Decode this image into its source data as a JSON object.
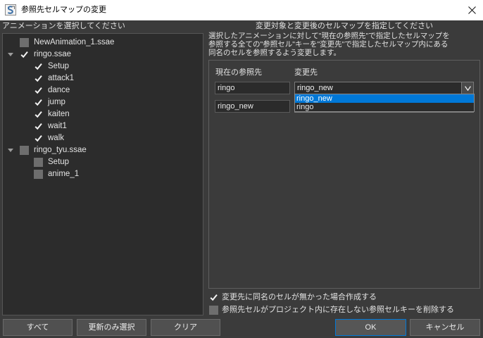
{
  "window": {
    "title": "参照先セルマップの変更"
  },
  "icons": {
    "app": "app-logo-icon",
    "close": "close-icon",
    "expand": "expand-arrow-icon",
    "dropdown": "chevron-down-icon",
    "check": "check-icon"
  },
  "animations": {
    "label": "アニメーションを選択してください",
    "tree": [
      {
        "label": "NewAnimation_1.ssae",
        "checked": false
      },
      {
        "label": "ringo.ssae",
        "checked": true,
        "expanded": true,
        "children": [
          {
            "label": "Setup",
            "checked": true
          },
          {
            "label": "attack1",
            "checked": true
          },
          {
            "label": "dance",
            "checked": true
          },
          {
            "label": "jump",
            "checked": true
          },
          {
            "label": "kaiten",
            "checked": true
          },
          {
            "label": "wait1",
            "checked": true
          },
          {
            "label": "walk",
            "checked": true
          }
        ]
      },
      {
        "label": "ringo_tyu.ssae",
        "checked": false,
        "expanded": true,
        "children": [
          {
            "label": "Setup",
            "checked": false
          },
          {
            "label": "anime_1",
            "checked": false
          }
        ]
      }
    ]
  },
  "cellmap": {
    "heading": "変更対象と変更後のセルマップを指定してください",
    "description": [
      "選択したアニメーションに対して\"現在の参照先\"で指定したセルマップを",
      "参照する全ての\"参照セル\"キーを\"変更先\"で指定したセルマップ内にある",
      "同名のセルを参照するよう変更します。"
    ],
    "column_current": "現在の参照先",
    "column_target": "変更先",
    "rows": [
      {
        "current": "ringo",
        "target": "ringo_new"
      },
      {
        "current": "ringo_new"
      }
    ],
    "dropdown_options": [
      {
        "label": "ringo_new",
        "highlighted": true
      },
      {
        "label": "ringo",
        "highlighted": false
      }
    ]
  },
  "options": [
    {
      "label": "変更先に同名のセルが無かった場合作成する",
      "checked": true
    },
    {
      "label": "参照先セルがプロジェクト内に存在しない参照セルキーを削除する",
      "checked": false
    }
  ],
  "buttons": {
    "select_all": "すべて",
    "select_updated": "更新のみ選択",
    "clear": "クリア",
    "ok": "OK",
    "cancel": "キャンセル"
  },
  "colors": {
    "accent": "#0078d7"
  }
}
